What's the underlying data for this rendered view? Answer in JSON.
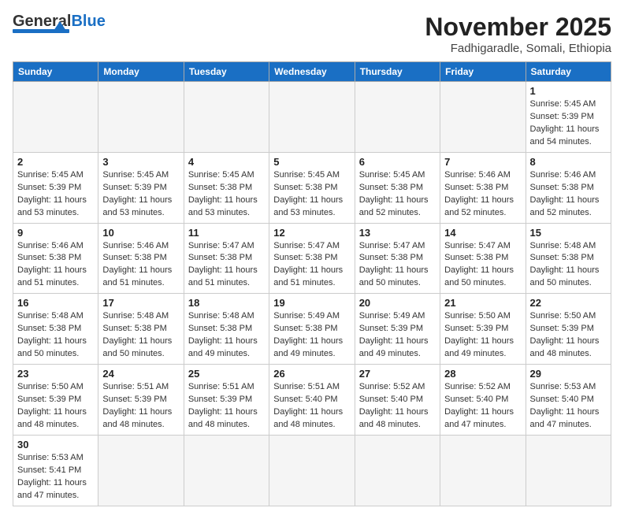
{
  "header": {
    "logo_general": "General",
    "logo_blue": "Blue",
    "month_title": "November 2025",
    "location": "Fadhigaradle, Somali, Ethiopia"
  },
  "days_of_week": [
    "Sunday",
    "Monday",
    "Tuesday",
    "Wednesday",
    "Thursday",
    "Friday",
    "Saturday"
  ],
  "weeks": [
    [
      {
        "day": "",
        "info": ""
      },
      {
        "day": "",
        "info": ""
      },
      {
        "day": "",
        "info": ""
      },
      {
        "day": "",
        "info": ""
      },
      {
        "day": "",
        "info": ""
      },
      {
        "day": "",
        "info": ""
      },
      {
        "day": "1",
        "info": "Sunrise: 5:45 AM\nSunset: 5:39 PM\nDaylight: 11 hours\nand 54 minutes."
      }
    ],
    [
      {
        "day": "2",
        "info": "Sunrise: 5:45 AM\nSunset: 5:39 PM\nDaylight: 11 hours\nand 53 minutes."
      },
      {
        "day": "3",
        "info": "Sunrise: 5:45 AM\nSunset: 5:39 PM\nDaylight: 11 hours\nand 53 minutes."
      },
      {
        "day": "4",
        "info": "Sunrise: 5:45 AM\nSunset: 5:38 PM\nDaylight: 11 hours\nand 53 minutes."
      },
      {
        "day": "5",
        "info": "Sunrise: 5:45 AM\nSunset: 5:38 PM\nDaylight: 11 hours\nand 53 minutes."
      },
      {
        "day": "6",
        "info": "Sunrise: 5:45 AM\nSunset: 5:38 PM\nDaylight: 11 hours\nand 52 minutes."
      },
      {
        "day": "7",
        "info": "Sunrise: 5:46 AM\nSunset: 5:38 PM\nDaylight: 11 hours\nand 52 minutes."
      },
      {
        "day": "8",
        "info": "Sunrise: 5:46 AM\nSunset: 5:38 PM\nDaylight: 11 hours\nand 52 minutes."
      }
    ],
    [
      {
        "day": "9",
        "info": "Sunrise: 5:46 AM\nSunset: 5:38 PM\nDaylight: 11 hours\nand 51 minutes."
      },
      {
        "day": "10",
        "info": "Sunrise: 5:46 AM\nSunset: 5:38 PM\nDaylight: 11 hours\nand 51 minutes."
      },
      {
        "day": "11",
        "info": "Sunrise: 5:47 AM\nSunset: 5:38 PM\nDaylight: 11 hours\nand 51 minutes."
      },
      {
        "day": "12",
        "info": "Sunrise: 5:47 AM\nSunset: 5:38 PM\nDaylight: 11 hours\nand 51 minutes."
      },
      {
        "day": "13",
        "info": "Sunrise: 5:47 AM\nSunset: 5:38 PM\nDaylight: 11 hours\nand 50 minutes."
      },
      {
        "day": "14",
        "info": "Sunrise: 5:47 AM\nSunset: 5:38 PM\nDaylight: 11 hours\nand 50 minutes."
      },
      {
        "day": "15",
        "info": "Sunrise: 5:48 AM\nSunset: 5:38 PM\nDaylight: 11 hours\nand 50 minutes."
      }
    ],
    [
      {
        "day": "16",
        "info": "Sunrise: 5:48 AM\nSunset: 5:38 PM\nDaylight: 11 hours\nand 50 minutes."
      },
      {
        "day": "17",
        "info": "Sunrise: 5:48 AM\nSunset: 5:38 PM\nDaylight: 11 hours\nand 50 minutes."
      },
      {
        "day": "18",
        "info": "Sunrise: 5:48 AM\nSunset: 5:38 PM\nDaylight: 11 hours\nand 49 minutes."
      },
      {
        "day": "19",
        "info": "Sunrise: 5:49 AM\nSunset: 5:38 PM\nDaylight: 11 hours\nand 49 minutes."
      },
      {
        "day": "20",
        "info": "Sunrise: 5:49 AM\nSunset: 5:39 PM\nDaylight: 11 hours\nand 49 minutes."
      },
      {
        "day": "21",
        "info": "Sunrise: 5:50 AM\nSunset: 5:39 PM\nDaylight: 11 hours\nand 49 minutes."
      },
      {
        "day": "22",
        "info": "Sunrise: 5:50 AM\nSunset: 5:39 PM\nDaylight: 11 hours\nand 48 minutes."
      }
    ],
    [
      {
        "day": "23",
        "info": "Sunrise: 5:50 AM\nSunset: 5:39 PM\nDaylight: 11 hours\nand 48 minutes."
      },
      {
        "day": "24",
        "info": "Sunrise: 5:51 AM\nSunset: 5:39 PM\nDaylight: 11 hours\nand 48 minutes."
      },
      {
        "day": "25",
        "info": "Sunrise: 5:51 AM\nSunset: 5:39 PM\nDaylight: 11 hours\nand 48 minutes."
      },
      {
        "day": "26",
        "info": "Sunrise: 5:51 AM\nSunset: 5:40 PM\nDaylight: 11 hours\nand 48 minutes."
      },
      {
        "day": "27",
        "info": "Sunrise: 5:52 AM\nSunset: 5:40 PM\nDaylight: 11 hours\nand 48 minutes."
      },
      {
        "day": "28",
        "info": "Sunrise: 5:52 AM\nSunset: 5:40 PM\nDaylight: 11 hours\nand 47 minutes."
      },
      {
        "day": "29",
        "info": "Sunrise: 5:53 AM\nSunset: 5:40 PM\nDaylight: 11 hours\nand 47 minutes."
      }
    ],
    [
      {
        "day": "30",
        "info": "Sunrise: 5:53 AM\nSunset: 5:41 PM\nDaylight: 11 hours\nand 47 minutes."
      },
      {
        "day": "",
        "info": ""
      },
      {
        "day": "",
        "info": ""
      },
      {
        "day": "",
        "info": ""
      },
      {
        "day": "",
        "info": ""
      },
      {
        "day": "",
        "info": ""
      },
      {
        "day": "",
        "info": ""
      }
    ]
  ]
}
